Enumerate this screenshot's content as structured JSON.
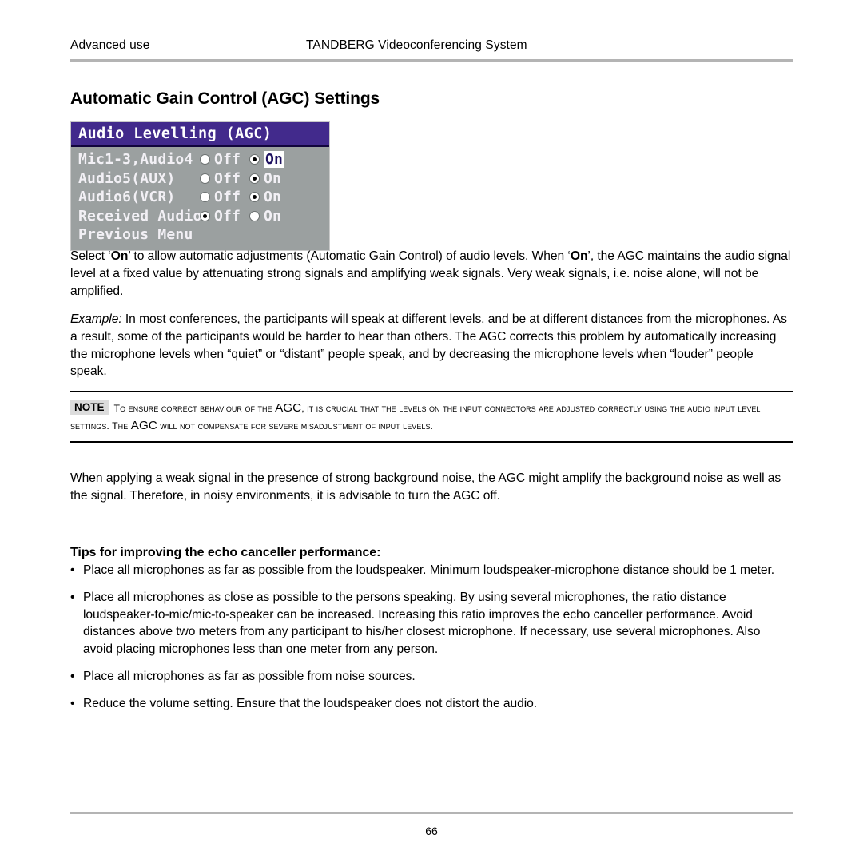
{
  "header": {
    "left": "Advanced use",
    "center": "TANDBERG Videoconferencing System"
  },
  "title": "Automatic Gain Control (AGC) Settings",
  "osd_menu": {
    "title": "Audio Levelling (AGC)",
    "rows": [
      {
        "label": "Mic1-3,Audio4",
        "off_label": "Off",
        "on_label": "On",
        "selected": "On",
        "cursor_on": true
      },
      {
        "label": "Audio5(AUX)",
        "off_label": "Off",
        "on_label": "On",
        "selected": "On",
        "cursor_on": false
      },
      {
        "label": "Audio6(VCR)",
        "off_label": "Off",
        "on_label": "On",
        "selected": "On",
        "cursor_on": false
      },
      {
        "label": "Received Audio",
        "off_label": "Off",
        "on_label": "On",
        "selected": "Off",
        "cursor_on": false
      }
    ],
    "previous_menu": "Previous Menu",
    "colors": {
      "title_bar": "#422a8c",
      "body": "#9ba0a0",
      "text": "#f2f0f5",
      "cursor_bg": "#ffffff",
      "cursor_text": "#1d1060"
    }
  },
  "paragraph_1_parts": {
    "a": "Select ‘",
    "b": "On",
    "c": "’ to allow automatic adjustments (Automatic Gain Control) of audio levels. When ‘",
    "d": "On",
    "e": "’, the AGC maintains the audio signal level at a fixed value by attenuating strong signals and amplifying weak signals. Very weak signals, i.e. noise alone, will not be amplified."
  },
  "paragraph_2_parts": {
    "label": "Example:",
    "text": " In most conferences, the participants will speak at different levels, and be at different distances from the microphones. As a result, some of the participants would be harder to hear than others. The AGC corrects this problem by automatically increasing the microphone levels when “quiet” or “distant” people speak, and by decreasing the microphone levels when “louder” people speak."
  },
  "note": {
    "badge": "NOTE",
    "line1_a": "To ensure correct behaviour of the ",
    "line1_agc": "AGC",
    "line1_b": ", it is crucial that the levels on the input connectors are adjusted correctly using the audio input level settings. ",
    "line2_a": "The ",
    "line2_agc": "AGC",
    "line2_b": " will not compensate for severe misadjustment of input levels."
  },
  "paragraph_3": "When applying a weak signal in the presence of strong background noise, the AGC might amplify the background noise as well as the signal. Therefore, in noisy environments, it is advisable to turn the AGC off.",
  "tips_heading": "Tips for improving the echo canceller performance:",
  "tips": [
    {
      "bullet": "•",
      "text": "Place all microphones as far as possible from the loudspeaker. Minimum loudspeaker-microphone distance should be 1 meter."
    },
    {
      "bullet": "•",
      "text": "Place all microphones as close as possible to the persons speaking. By using several microphones, the ratio distance loudspeaker-to-mic/mic-to-speaker can be increased. Increasing this ratio improves the echo canceller performance. Avoid distances above two meters from any participant to his/her closest microphone. If necessary, use several microphones. Also avoid placing microphones less than one meter from any person."
    },
    {
      "bullet": "•",
      "text": "Place all microphones as far as possible from noise sources."
    },
    {
      "bullet": "•",
      "text": "Reduce the volume setting. Ensure that the loudspeaker does not distort the audio."
    }
  ],
  "footer": {
    "page_number": "66"
  }
}
